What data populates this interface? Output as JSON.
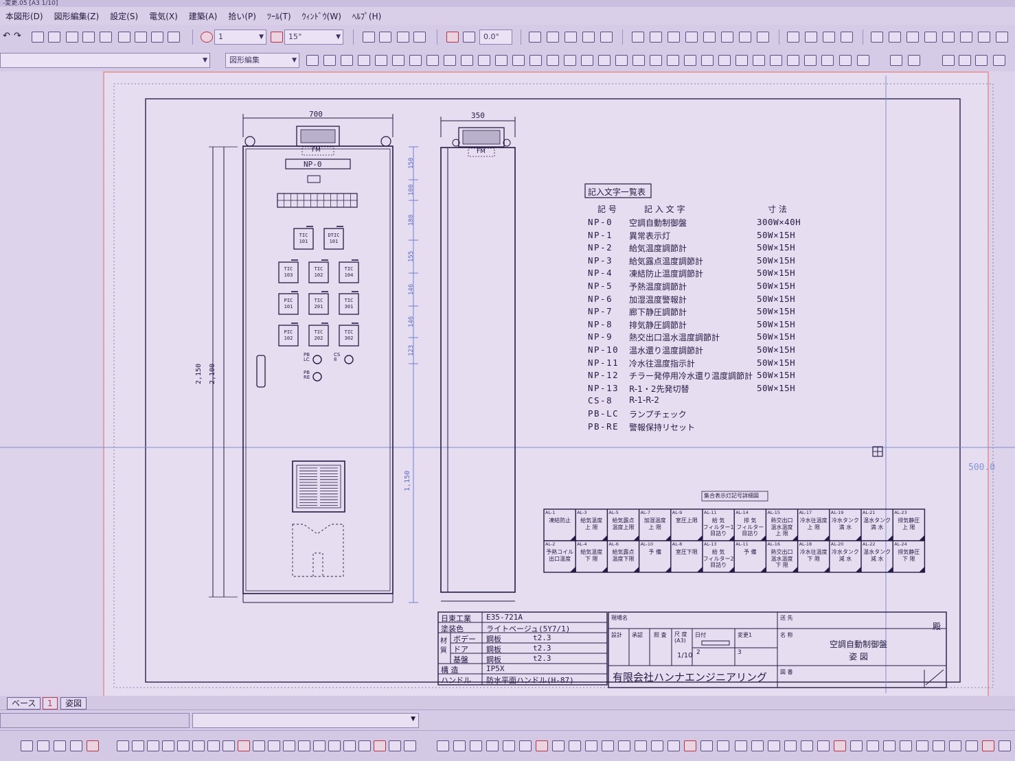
{
  "window": {
    "title": "-変更.05 [A3 1/10]"
  },
  "menu": [
    "本図形(D)",
    "図形編集(Z)",
    "設定(S)",
    "電気(X)",
    "建築(A)",
    "拾い(P)",
    "ﾂｰﾙ(T)",
    "ｳｨﾝﾄﾞｳ(W)",
    "ﾍﾙﾌﾟ(H)"
  ],
  "toolbar": {
    "layer_value": "1",
    "angle_value": "15°",
    "rotation_value": "0.0°",
    "mode_combo": "図形編集"
  },
  "drawing": {
    "front_width": "700",
    "side_width": "350",
    "total_height": "2,150",
    "body_height": "2,100",
    "lower_dim": "1,150",
    "dims_right": [
      "150",
      "100",
      "180",
      "155",
      "146",
      "146",
      "123"
    ],
    "fm_label": "FM",
    "np0_label": "NP-0",
    "gauges": [
      {
        "label": "TIC\n101"
      },
      {
        "label": "DTIC\n101"
      },
      {
        "label": "TIC\n103"
      },
      {
        "label": "TIC\n102"
      },
      {
        "label": "TIC\n104"
      },
      {
        "label": "PIC\n101"
      },
      {
        "label": "TIC\n201"
      },
      {
        "label": "TIC\n301"
      },
      {
        "label": "PIC\n102"
      },
      {
        "label": "TIC\n202"
      },
      {
        "label": "TIC\n302"
      }
    ],
    "pb_lc": "PB\nLC",
    "cs": "CS\n8",
    "pb_re": "PB\nRE",
    "coord_readout": "500.0"
  },
  "legend": {
    "title": "記入文字一覧表",
    "headers": [
      "記 号",
      "記 入 文 字",
      "寸 法"
    ],
    "rows": [
      {
        "code": "NP-0",
        "text": "空調自動制御盤",
        "size": "300W×40H"
      },
      {
        "code": "NP-1",
        "text": "異常表示灯",
        "size": "50W×15H"
      },
      {
        "code": "NP-2",
        "text": "給気温度調節計",
        "size": "50W×15H"
      },
      {
        "code": "NP-3",
        "text": "給気露点温度調節計",
        "size": "50W×15H"
      },
      {
        "code": "NP-4",
        "text": "凍結防止温度調節計",
        "size": "50W×15H"
      },
      {
        "code": "NP-5",
        "text": "予熱温度調節計",
        "size": "50W×15H"
      },
      {
        "code": "NP-6",
        "text": "加湿温度警報計",
        "size": "50W×15H"
      },
      {
        "code": "NP-7",
        "text": "廊下静圧調節計",
        "size": "50W×15H"
      },
      {
        "code": "NP-8",
        "text": "排気静圧調節計",
        "size": "50W×15H"
      },
      {
        "code": "NP-9",
        "text": "熱交出口温水温度調節計",
        "size": "50W×15H"
      },
      {
        "code": "NP-10",
        "text": "温水還り温度調節計",
        "size": "50W×15H"
      },
      {
        "code": "NP-11",
        "text": "冷水往温度指示計",
        "size": "50W×15H"
      },
      {
        "code": "NP-12",
        "text": "チラー発停用冷水還り温度調節計",
        "size": "50W×15H"
      },
      {
        "code": "NP-13",
        "text": "R-1・2先発切替",
        "size": "50W×15H"
      },
      {
        "code": "CS-8",
        "text": "R-1-R-2",
        "size": ""
      },
      {
        "code": "PB-LC",
        "text": "ランプチェック",
        "size": ""
      },
      {
        "code": "PB-RE",
        "text": "警報保持リセット",
        "size": ""
      }
    ]
  },
  "alarm_table": {
    "title": "集合表示灯記号詳細図",
    "top": [
      {
        "code": "AL-1",
        "text": "凍結防止"
      },
      {
        "code": "AL-3",
        "text": "給気温度\n上 限"
      },
      {
        "code": "AL-5",
        "text": "給気露点\n温度上限"
      },
      {
        "code": "AL-7",
        "text": "加湿温度\n上 限"
      },
      {
        "code": "AL-9",
        "text": "室圧上限"
      },
      {
        "code": "AL-11",
        "text": "給 気\nフィルター1\n目詰り"
      },
      {
        "code": "AL-14",
        "text": "排 気\nフィルター\n目詰り"
      },
      {
        "code": "AL-15",
        "text": "熱交出口\n温水温度\n上 限"
      },
      {
        "code": "AL-17",
        "text": "冷水往温度\n上 限"
      },
      {
        "code": "AL-19",
        "text": "冷水タンク\n満 水"
      },
      {
        "code": "AL-21",
        "text": "温水タンク\n満 水"
      },
      {
        "code": "AL-23",
        "text": "排気静圧\n上 限"
      }
    ],
    "bottom": [
      {
        "code": "AL-2",
        "text": "予熱コイル\n出口温度"
      },
      {
        "code": "AL-4",
        "text": "給気温度\n下 限"
      },
      {
        "code": "AL-6",
        "text": "給気露点\n温度下限"
      },
      {
        "code": "AL-10",
        "text": "予 備"
      },
      {
        "code": "AL-8",
        "text": "室圧下限"
      },
      {
        "code": "AL-13",
        "text": "給 気\nフィルター2\n目詰り"
      },
      {
        "code": "AL-11",
        "text": "予 備"
      },
      {
        "code": "AL-16",
        "text": "熱交出口\n温水温度\n下 限"
      },
      {
        "code": "AL-18",
        "text": "冷水往温度\n下 限"
      },
      {
        "code": "AL-20",
        "text": "冷水タンク\n減 水"
      },
      {
        "code": "AL-22",
        "text": "温水タンク\n減 水"
      },
      {
        "code": "AL-24",
        "text": "排気静圧\n下 限"
      }
    ]
  },
  "specs": {
    "rows": [
      {
        "label": "日東工業",
        "value": "E35-721A",
        "thick": ""
      },
      {
        "label": "塗装色",
        "value": "ライトベージュ(5Y7/1)",
        "thick": ""
      },
      {
        "label": "ボデー",
        "value": "鋼板",
        "thick": "t2.3"
      },
      {
        "label": "ドア",
        "value": "鋼板",
        "thick": "t2.3"
      },
      {
        "label": "基盤",
        "value": "鋼板",
        "thick": "t2.3"
      },
      {
        "label": "構 造",
        "value": "IP5X",
        "thick": ""
      },
      {
        "label": "ハンドル",
        "value": "防水平面ハンドル(H-87)",
        "thick": ""
      }
    ],
    "material_label": "材\n質"
  },
  "title_block": {
    "project_label": "現場名",
    "to_label": "送 先",
    "honorific": "殿",
    "columns": [
      "設計",
      "承認",
      "照 査",
      "尺 度 (A3)",
      "日付",
      "変更1"
    ],
    "scale": "1/10",
    "rev_nums": [
      "2",
      "3"
    ],
    "name_label": "名 称",
    "name_line1": "空調自動制御盤",
    "name_line2": "姿 図",
    "drawing_no_label": "図 番",
    "company": "有限会社ハンナエンジニアリング"
  },
  "tabs": [
    "ベース",
    "1",
    "姿図"
  ]
}
